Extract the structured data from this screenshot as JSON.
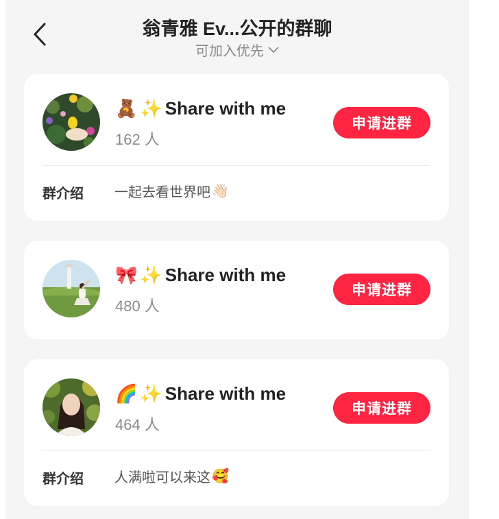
{
  "header": {
    "title": "翁青雅 Ev...公开的群聊",
    "subtitle": "可加入优先"
  },
  "groups": [
    {
      "emoji": "🧸",
      "sparkle": "✨",
      "name": "Share with me",
      "count": "162 人",
      "join_label": "申请进群",
      "intro_label": "群介绍",
      "intro": "一起去看世界吧",
      "intro_emoji": "👋🏻"
    },
    {
      "emoji": "🎀",
      "sparkle": "✨",
      "name": "Share with me",
      "count": "480 人",
      "join_label": "申请进群"
    },
    {
      "emoji": "🌈",
      "sparkle": "✨",
      "name": "Share with me",
      "count": "464 人",
      "join_label": "申请进群",
      "intro_label": "群介绍",
      "intro": "人满啦可以来这",
      "intro_emoji": "🥰"
    }
  ],
  "colors": {
    "accent": "#ff2442",
    "background": "#f5f5f5",
    "card": "#ffffff"
  }
}
